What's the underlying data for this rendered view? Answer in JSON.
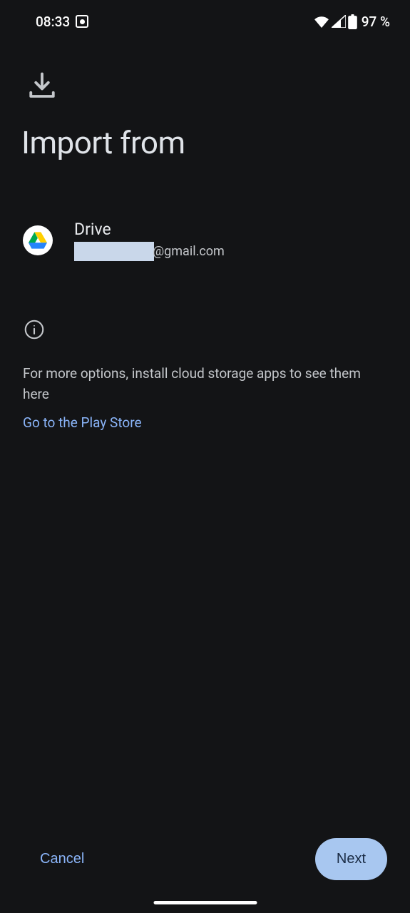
{
  "status": {
    "time": "08:33",
    "battery": "97 %"
  },
  "header": {
    "title": "Import from"
  },
  "option": {
    "title": "Drive",
    "email_suffix": "@gmail.com"
  },
  "info": {
    "text": "For more options, install cloud storage apps to see them here",
    "link": "Go to the Play Store"
  },
  "footer": {
    "cancel": "Cancel",
    "next": "Next"
  }
}
